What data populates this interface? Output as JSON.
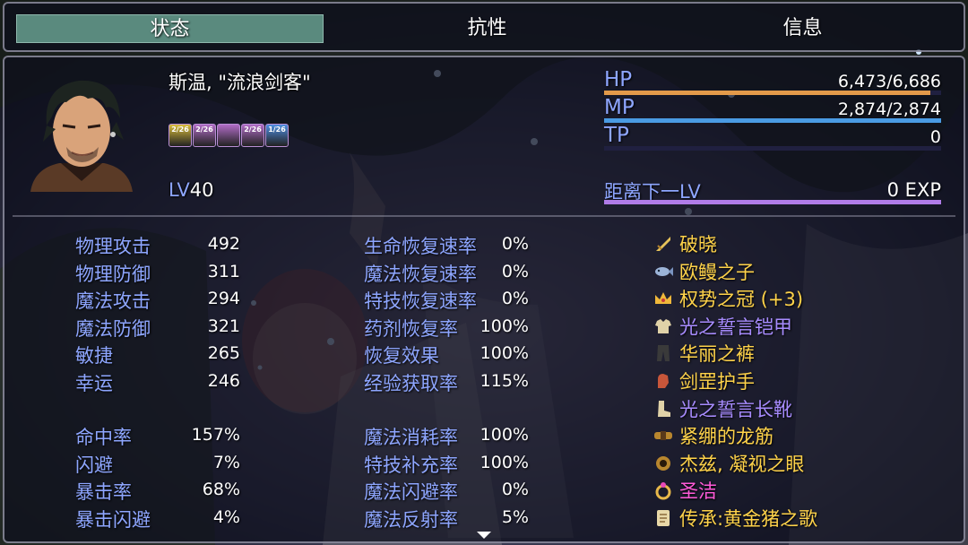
{
  "tabs": [
    {
      "label": "状态"
    },
    {
      "label": "抗性"
    },
    {
      "label": "信息"
    }
  ],
  "character": {
    "name": "斯温, \"流浪剑客\"",
    "level_label": "LV",
    "level": "40"
  },
  "states": [
    {
      "text": "2/26",
      "color": "#d9bd3c",
      "icon": "gold-buff-icon"
    },
    {
      "text": "2/26",
      "color": "#b16cc6",
      "icon": "purple-buff-icon"
    },
    {
      "text": "",
      "color": "#b16cc6",
      "icon": "beetle-buff-icon"
    },
    {
      "text": "2/26",
      "color": "#b16cc6",
      "icon": "purple-buff-icon"
    },
    {
      "text": "1/26",
      "color": "#4f8ee0",
      "icon": "blue-buff-icon"
    }
  ],
  "gauges": {
    "hp": {
      "label": "HP",
      "value": "6,473/6,686",
      "current": 6473,
      "max": 6686,
      "color": "#e39a4a"
    },
    "mp": {
      "label": "MP",
      "value": "2,874/2,874",
      "current": 2874,
      "max": 2874,
      "color": "#4a9be3"
    },
    "tp": {
      "label": "TP",
      "value": "0",
      "current": 0,
      "max": 100,
      "color": "#4a9b5a"
    },
    "exp": {
      "label": "距离下一LV",
      "value": "0 EXP",
      "current": 1,
      "max": 1,
      "color": "#b07ce8"
    }
  },
  "base_stats": [
    {
      "label": "物理攻击",
      "value": "492"
    },
    {
      "label": "物理防御",
      "value": "311"
    },
    {
      "label": "魔法攻击",
      "value": "294"
    },
    {
      "label": "魔法防御",
      "value": "321"
    },
    {
      "label": "敏捷",
      "value": "265"
    },
    {
      "label": "幸运",
      "value": "246"
    }
  ],
  "ex_stats": [
    {
      "label": "命中率",
      "value": "157%"
    },
    {
      "label": "闪避",
      "value": "7%"
    },
    {
      "label": "暴击率",
      "value": "68%"
    },
    {
      "label": "暴击闪避",
      "value": "4%"
    }
  ],
  "rate_stats": [
    {
      "label": "生命恢复速率",
      "value": "0%"
    },
    {
      "label": "魔法恢复速率",
      "value": "0%"
    },
    {
      "label": "特技恢复速率",
      "value": "0%"
    },
    {
      "label": "药剂恢复率",
      "value": "100%"
    },
    {
      "label": "恢复效果",
      "value": "100%"
    },
    {
      "label": "经验获取率",
      "value": "115%"
    }
  ],
  "sp_stats": [
    {
      "label": "魔法消耗率",
      "value": "100%"
    },
    {
      "label": "特技补充率",
      "value": "100%"
    },
    {
      "label": "魔法闪避率",
      "value": "0%"
    },
    {
      "label": "魔法反射率",
      "value": "5%"
    }
  ],
  "equipment": [
    {
      "name": "破晓",
      "color": "#ffd34a",
      "icon": "sword-icon"
    },
    {
      "name": "欧鳗之子",
      "color": "#ffd34a",
      "icon": "fish-icon"
    },
    {
      "name": "权势之冠 (+3)",
      "color": "#ffd34a",
      "icon": "crown-icon"
    },
    {
      "name": "光之誓言铠甲",
      "color": "#a88cff",
      "icon": "armor-icon"
    },
    {
      "name": "华丽之裤",
      "color": "#ffd34a",
      "icon": "pants-icon"
    },
    {
      "name": "剑罡护手",
      "color": "#ffd34a",
      "icon": "gauntlet-icon"
    },
    {
      "name": "光之誓言长靴",
      "color": "#a88cff",
      "icon": "boots-icon"
    },
    {
      "name": "紧绷的龙筋",
      "color": "#ffd34a",
      "icon": "belt-icon"
    },
    {
      "name": "杰兹, 凝视之眼",
      "color": "#ffd34a",
      "icon": "eye-amulet-icon"
    },
    {
      "name": "圣洁",
      "color": "#ff5ad8",
      "icon": "ring-icon"
    },
    {
      "name": "传承:黄金猪之歌",
      "color": "#ffd34a",
      "icon": "scroll-icon"
    }
  ]
}
